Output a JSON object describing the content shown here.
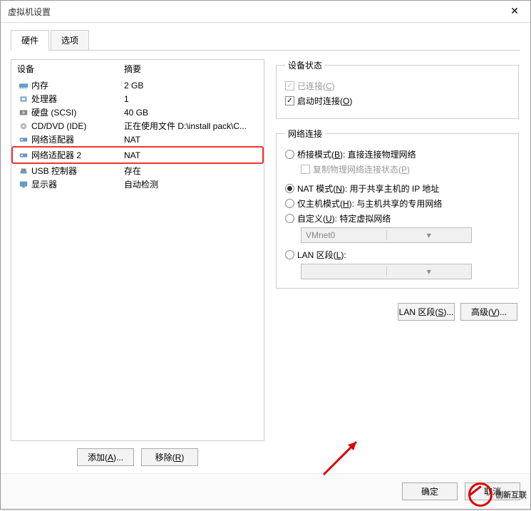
{
  "window": {
    "title": "虚拟机设置"
  },
  "tabs": {
    "hw": "硬件",
    "opt": "选项"
  },
  "list": {
    "head": {
      "device": "设备",
      "summary": "摘要"
    },
    "rows": [
      {
        "icon": "mem",
        "label": "内存",
        "value": "2 GB"
      },
      {
        "icon": "cpu",
        "label": "处理器",
        "value": "1"
      },
      {
        "icon": "disk",
        "label": "硬盘 (SCSI)",
        "value": "40 GB"
      },
      {
        "icon": "cd",
        "label": "CD/DVD (IDE)",
        "value": "正在使用文件 D:\\install pack\\C..."
      },
      {
        "icon": "net",
        "label": "网络适配器",
        "value": "NAT"
      },
      {
        "icon": "net",
        "label": "网络适配器 2",
        "value": "NAT",
        "highlighted": true
      },
      {
        "icon": "usb",
        "label": "USB 控制器",
        "value": "存在"
      },
      {
        "icon": "display",
        "label": "显示器",
        "value": "自动检测"
      }
    ]
  },
  "left_btns": {
    "add": "添加(A)...",
    "remove": "移除(R)"
  },
  "status": {
    "legend": "设备状态",
    "connected": "已连接(C)",
    "autostart": "启动时连接(O)"
  },
  "net": {
    "legend": "网络连接",
    "bridged": "桥接模式(B): 直接连接物理网络",
    "replicate": "复制物理网络连接状态(P)",
    "nat": "NAT 模式(N): 用于共享主机的 IP 地址",
    "hostonly": "仅主机模式(H): 与主机共享的专用网络",
    "custom": "自定义(U): 特定虚拟网络",
    "vmnet": "VMnet0",
    "lan": "LAN 区段(L):",
    "lan_btn": "LAN 区段(S)...",
    "adv_btn": "高级(V)..."
  },
  "footer": {
    "ok": "确定",
    "cancel": "取消"
  },
  "brand": "创新互联"
}
